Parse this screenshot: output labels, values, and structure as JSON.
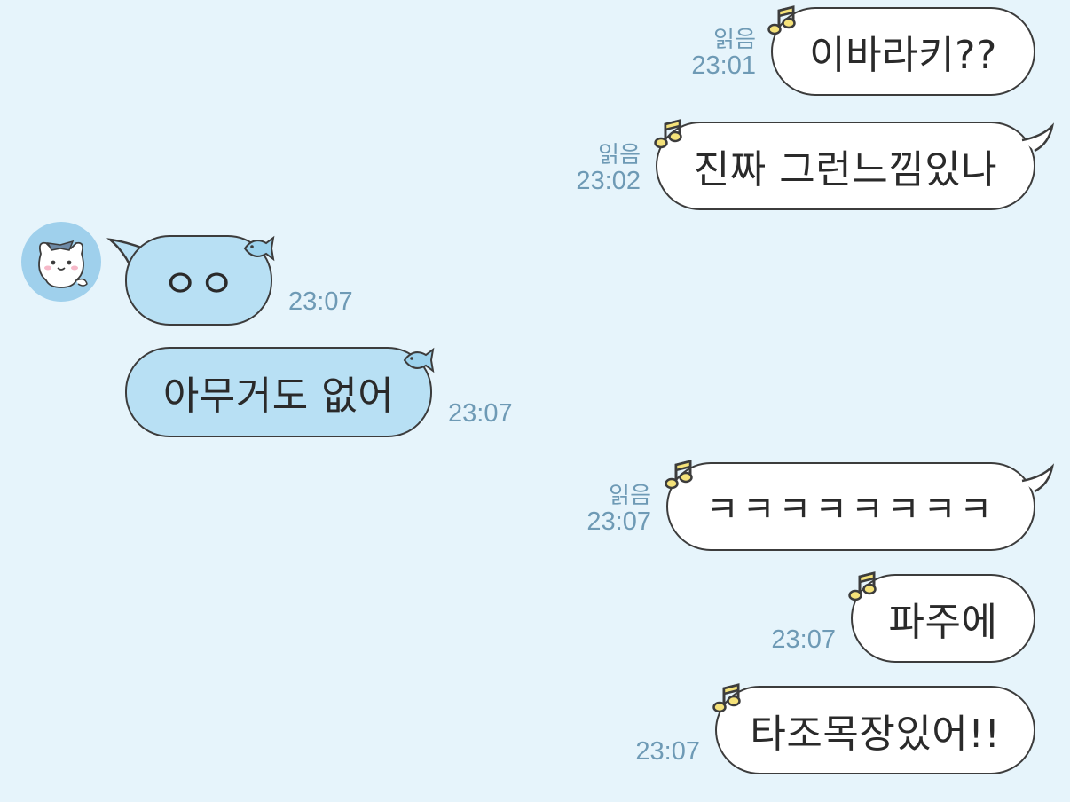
{
  "chat": {
    "messages": [
      {
        "side": "me",
        "text": "이바라키??",
        "read": "읽음",
        "time": "23:01"
      },
      {
        "side": "me",
        "text": "진짜 그런느낌있나",
        "read": "읽음",
        "time": "23:02"
      },
      {
        "side": "them",
        "text": "ㅇㅇ",
        "time": "23:07"
      },
      {
        "side": "them",
        "text": "아무거도 없어",
        "time": "23:07"
      },
      {
        "side": "me",
        "text": "ㅋㅋㅋㅋㅋㅋㅋㅋ",
        "read": "읽음",
        "time": "23:07"
      },
      {
        "side": "me",
        "text": "파주에",
        "time": "23:07"
      },
      {
        "side": "me",
        "text": "타조목장있어!!",
        "time": "23:07"
      }
    ]
  },
  "colors": {
    "background": "#e6f4fb",
    "my_bubble": "#ffffff",
    "their_bubble": "#b8e0f4",
    "timestamp": "#6e9ab5",
    "note_icon": "#f5e27a",
    "fish_icon": "#9dd3ee"
  },
  "icons": {
    "my_bubble_decoration": "music-note-icon",
    "their_bubble_decoration": "fish-icon",
    "avatar": "white-cat-character-avatar"
  }
}
